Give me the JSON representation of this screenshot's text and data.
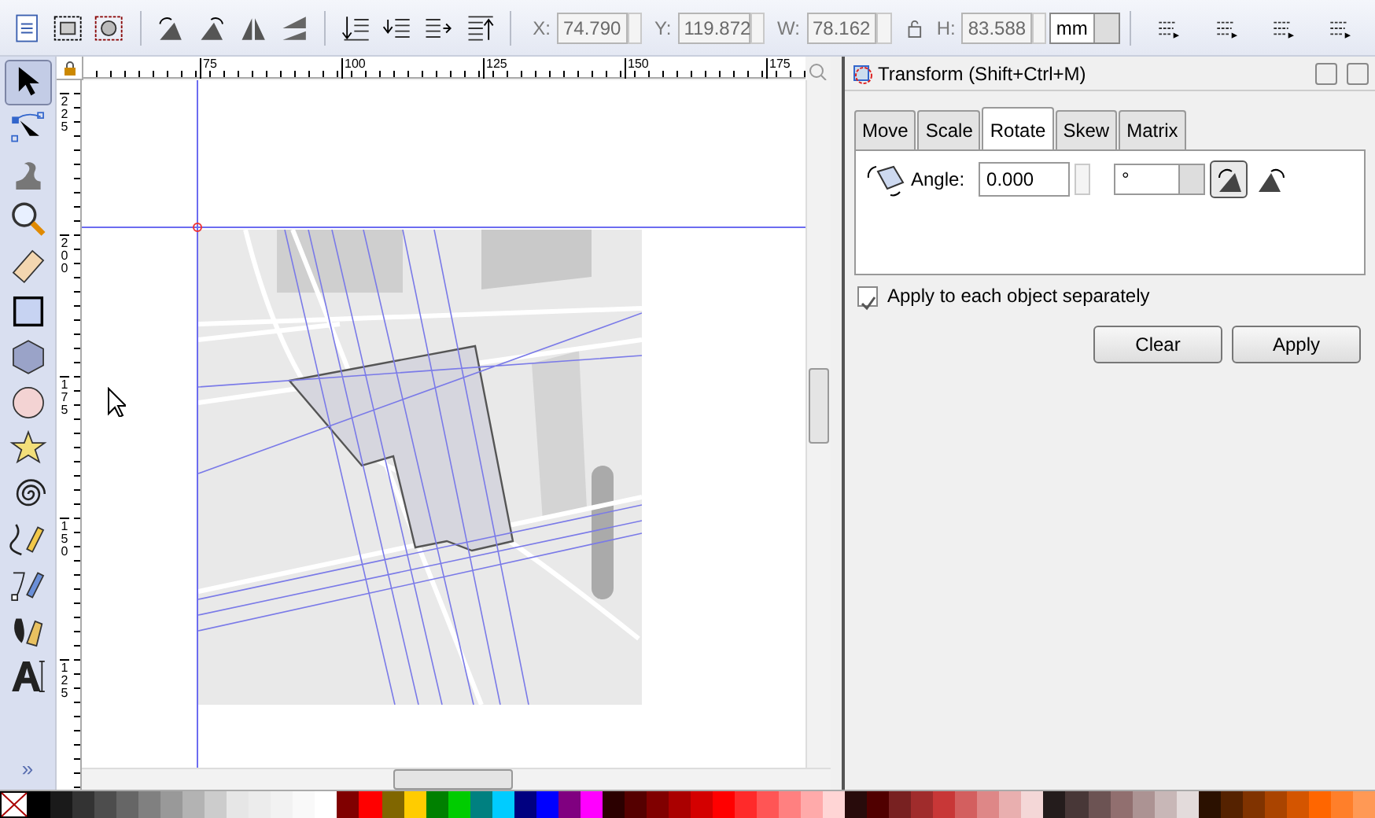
{
  "toolbar": {
    "fields": [
      {
        "label": "X:",
        "value": "74.790",
        "disabled": true
      },
      {
        "label": "Y:",
        "value": "119.872",
        "disabled": true
      },
      {
        "label": "W:",
        "value": "78.162",
        "disabled": true
      },
      {
        "label": "H:",
        "value": "83.588",
        "disabled": true
      }
    ],
    "unit": "mm"
  },
  "toolbox": {
    "tools": [
      {
        "kind": "selector",
        "selected": true
      },
      {
        "kind": "node",
        "selected": false
      },
      {
        "kind": "tweak",
        "selected": false
      },
      {
        "kind": "zoom",
        "selected": false
      },
      {
        "kind": "measure",
        "selected": false
      },
      {
        "kind": "rect",
        "selected": false
      },
      {
        "kind": "box3d",
        "selected": false
      },
      {
        "kind": "ellipse",
        "selected": false
      },
      {
        "kind": "star",
        "selected": false
      },
      {
        "kind": "spiral",
        "selected": false
      },
      {
        "kind": "pencil",
        "selected": false
      },
      {
        "kind": "pen",
        "selected": false
      },
      {
        "kind": "calligraphy",
        "selected": false
      },
      {
        "kind": "text",
        "selected": false
      }
    ],
    "more": "»"
  },
  "rulers": {
    "horizontal": [
      "75",
      "100",
      "125",
      "150",
      "175"
    ],
    "vertical": [
      "225",
      "200",
      "175",
      "150",
      "125"
    ]
  },
  "panel": {
    "title": "Transform (Shift+Ctrl+M)",
    "tabs": [
      {
        "label": "Move",
        "selected": false
      },
      {
        "label": "Scale",
        "selected": false
      },
      {
        "label": "Rotate",
        "selected": true
      },
      {
        "label": "Skew",
        "selected": false
      },
      {
        "label": "Matrix",
        "selected": false
      }
    ],
    "angle": {
      "label": "Angle:",
      "value": "0.000",
      "unit": "°"
    },
    "direction": [
      {
        "kind": "ccw",
        "selected": true
      },
      {
        "kind": "cw",
        "selected": false
      }
    ],
    "separately": {
      "label": "Apply to each object separately",
      "checked": true
    },
    "buttons": [
      "Clear",
      "Apply"
    ]
  },
  "palette": {
    "swatches": [
      {
        "color": "#000000"
      },
      {
        "color": "#1a1a1a"
      },
      {
        "color": "#333333"
      },
      {
        "color": "#4d4d4d"
      },
      {
        "color": "#666666"
      },
      {
        "color": "#808080"
      },
      {
        "color": "#999999"
      },
      {
        "color": "#b3b3b3"
      },
      {
        "color": "#cccccc"
      },
      {
        "color": "#e6e6e6"
      },
      {
        "color": "#ececec"
      },
      {
        "color": "#f2f2f2"
      },
      {
        "color": "#f9f9f9"
      },
      {
        "color": "#ffffff"
      },
      {
        "color": "#800000"
      },
      {
        "color": "#ff0000"
      },
      {
        "color": "#806600"
      },
      {
        "color": "#ffcc00"
      },
      {
        "color": "#008000"
      },
      {
        "color": "#00cc00"
      },
      {
        "color": "#008080"
      },
      {
        "color": "#00ccff"
      },
      {
        "color": "#000080"
      },
      {
        "color": "#0000ff"
      },
      {
        "color": "#800080"
      },
      {
        "color": "#ff00ff"
      },
      {
        "color": "#2b0000"
      },
      {
        "color": "#550000"
      },
      {
        "color": "#800000"
      },
      {
        "color": "#aa0000"
      },
      {
        "color": "#d40000"
      },
      {
        "color": "#ff0000"
      },
      {
        "color": "#ff2a2a"
      },
      {
        "color": "#ff5555"
      },
      {
        "color": "#ff8080"
      },
      {
        "color": "#ffaaaa"
      },
      {
        "color": "#ffd5d5"
      },
      {
        "color": "#280b0b"
      },
      {
        "color": "#500000"
      },
      {
        "color": "#782121"
      },
      {
        "color": "#a02c2c"
      },
      {
        "color": "#c83737"
      },
      {
        "color": "#d35f5f"
      },
      {
        "color": "#de8787"
      },
      {
        "color": "#e9afaf"
      },
      {
        "color": "#f4d7d7"
      },
      {
        "color": "#241c1c"
      },
      {
        "color": "#483737"
      },
      {
        "color": "#6c5353"
      },
      {
        "color": "#916f6f"
      },
      {
        "color": "#ac9393"
      },
      {
        "color": "#c8b7b7"
      },
      {
        "color": "#e3dbdb"
      },
      {
        "color": "#2b1100"
      },
      {
        "color": "#552200"
      },
      {
        "color": "#803300"
      },
      {
        "color": "#aa4400"
      },
      {
        "color": "#d45500"
      },
      {
        "color": "#ff6600"
      },
      {
        "color": "#ff7f2a"
      },
      {
        "color": "#ff9955"
      }
    ]
  }
}
